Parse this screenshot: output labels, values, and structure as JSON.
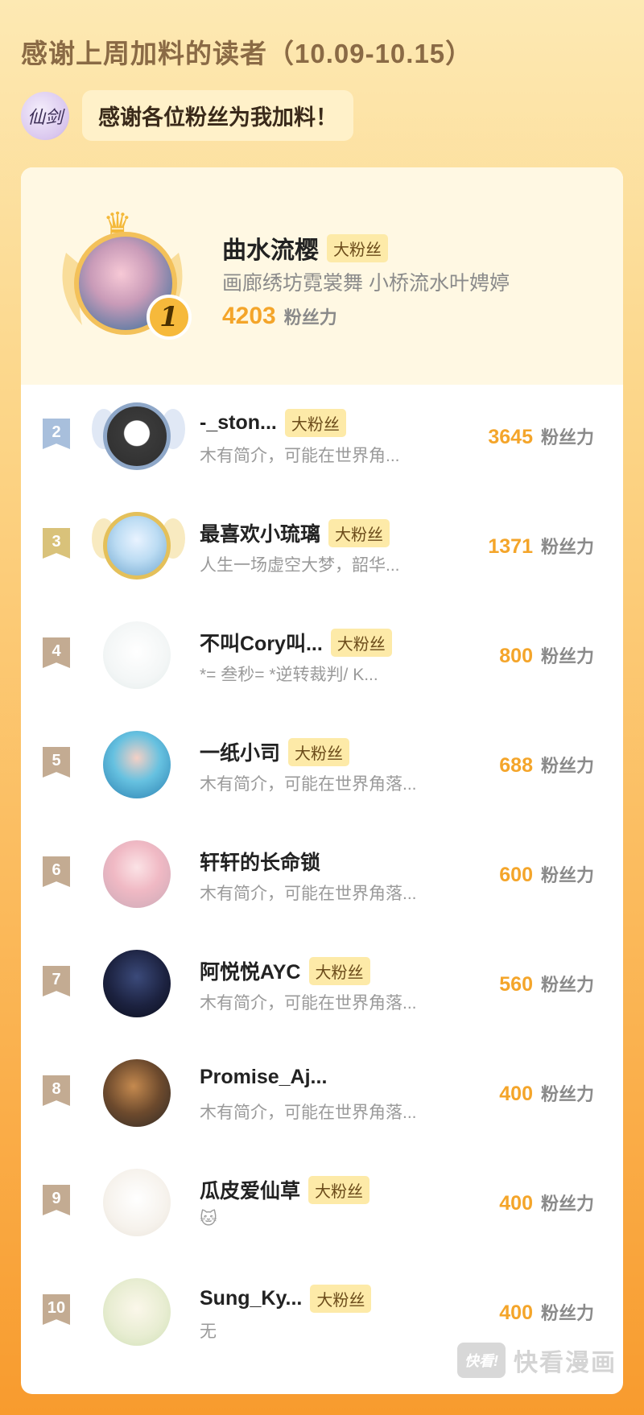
{
  "page": {
    "title": "感谢上周加料的读者（10.09-10.15）"
  },
  "header": {
    "logo_text": "仙剑",
    "message": "感谢各位粉丝为我加料！"
  },
  "top_fan": {
    "rank": "1",
    "name": "曲水流樱",
    "tag": "大粉丝",
    "bio": "画廊绣坊霓裳舞 小桥流水叶娉婷",
    "score": "4203",
    "unit": "粉丝力"
  },
  "fans": [
    {
      "rank": "2",
      "name": "-_ston...",
      "tag": "大粉丝",
      "bio": "木有简介，可能在世界角...",
      "score": "3645",
      "unit": "粉丝力"
    },
    {
      "rank": "3",
      "name": "最喜欢小琉璃",
      "tag": "大粉丝",
      "bio": "人生一场虚空大梦，韶华...",
      "score": "1371",
      "unit": "粉丝力"
    },
    {
      "rank": "4",
      "name": "不叫Cory叫...",
      "tag": "大粉丝",
      "bio": "*= 叁秒= *逆转裁判/ K...",
      "score": "800",
      "unit": "粉丝力"
    },
    {
      "rank": "5",
      "name": "一纸小司",
      "tag": "大粉丝",
      "bio": "木有简介，可能在世界角落...",
      "score": "688",
      "unit": "粉丝力"
    },
    {
      "rank": "6",
      "name": "轩轩的长命锁",
      "tag": "",
      "bio": "木有简介，可能在世界角落...",
      "score": "600",
      "unit": "粉丝力"
    },
    {
      "rank": "7",
      "name": "阿悦悦AYC",
      "tag": "大粉丝",
      "bio": "木有简介，可能在世界角落...",
      "score": "560",
      "unit": "粉丝力"
    },
    {
      "rank": "8",
      "name": "Promise_Aj...",
      "tag": "",
      "bio": "木有简介，可能在世界角落...",
      "score": "400",
      "unit": "粉丝力"
    },
    {
      "rank": "9",
      "name": "瓜皮爱仙草",
      "tag": "大粉丝",
      "bio": "🐱",
      "score": "400",
      "unit": "粉丝力"
    },
    {
      "rank": "10",
      "name": "Sung_Ky...",
      "tag": "大粉丝",
      "bio": "无",
      "score": "400",
      "unit": "粉丝力"
    }
  ],
  "watermark": {
    "logo": "快看!",
    "text": "快看漫画"
  }
}
